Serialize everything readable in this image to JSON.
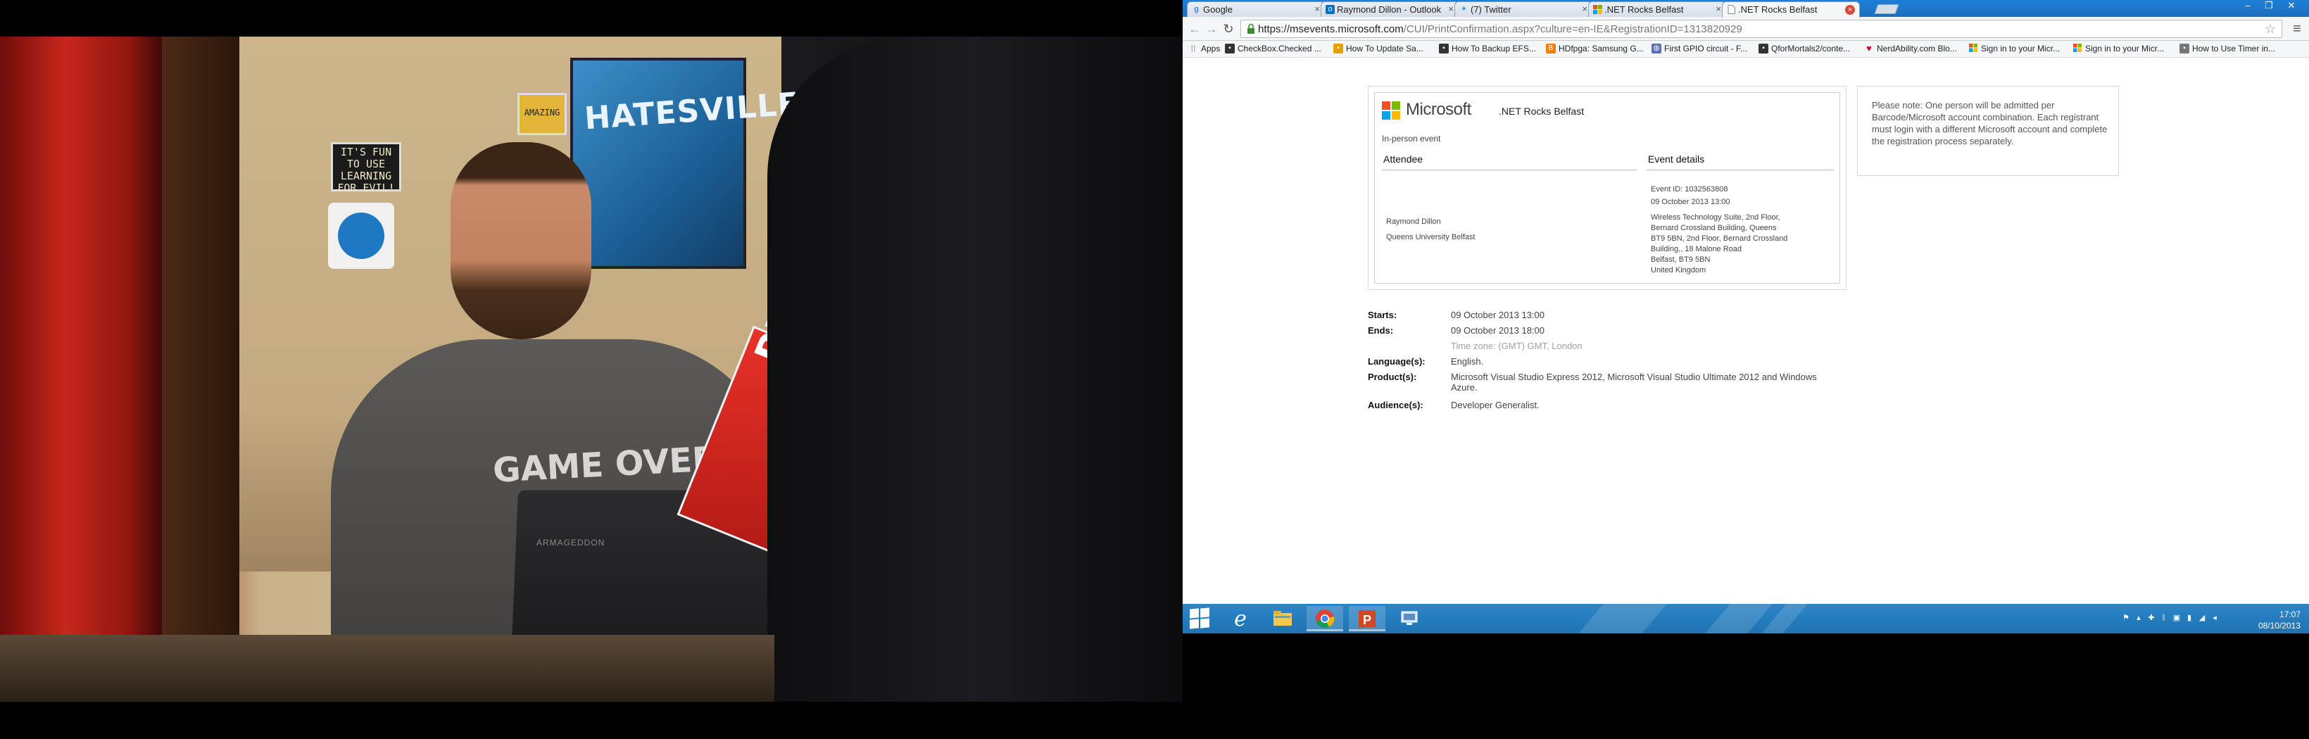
{
  "video": {
    "poster_text": "HATESVILLE!",
    "sticker_1": "IT'S FUN TO USE LEARNING FOR EVIL!",
    "sticker_2": "AMAZING",
    "shirt_text": "GAME OVER,",
    "laptop_label": "ARMAGEDDON",
    "book_text": "PUSSEY!"
  },
  "browser": {
    "tabs": [
      {
        "label": "Google",
        "icon": "google-icon",
        "color": "#4285f4"
      },
      {
        "label": "Raymond Dillon - Outlook",
        "icon": "outlook-icon",
        "color": "#0072c6"
      },
      {
        "label": "(7) Twitter",
        "icon": "twitter-icon",
        "color": "#1da1f2"
      },
      {
        "label": ".NET Rocks Belfast",
        "icon": "microsoft-icon",
        "color": "#f25022"
      },
      {
        "label": ".NET Rocks Belfast",
        "icon": "page-icon",
        "color": "#9aa0a6"
      }
    ],
    "url_host": "https://msevents.microsoft.com",
    "url_path": "/CUI/PrintConfirmation.aspx?culture=en-IE&RegistrationID=1313820929",
    "bookmarks": [
      {
        "label": "Apps",
        "icon": "apps-grid-icon",
        "color": "#5f6368"
      },
      {
        "label": "CheckBox.Checked ...",
        "icon": "bookmark-page-icon",
        "color": "#333333"
      },
      {
        "label": "How To Update Sa...",
        "icon": "bookmark-folder-icon",
        "color": "#e6a100"
      },
      {
        "label": "How To Backup EFS...",
        "icon": "bookmark-page-icon",
        "color": "#333333"
      },
      {
        "label": "HDfpga: Samsung G...",
        "icon": "blogger-icon",
        "color": "#f57d00"
      },
      {
        "label": "First GPIO circuit - F...",
        "icon": "globe-icon",
        "color": "#5b6fb5"
      },
      {
        "label": "QforMortals2/conte...",
        "icon": "bookmark-page-icon",
        "color": "#333333"
      },
      {
        "label": "NerdAbility.com Blo...",
        "icon": "heart-icon",
        "color": "#d0021b"
      },
      {
        "label": "Sign in to your Micr...",
        "icon": "microsoft-icon",
        "color": "#f25022"
      },
      {
        "label": "Sign in to your Micr...",
        "icon": "microsoft-icon",
        "color": "#f25022"
      },
      {
        "label": "How to Use Timer in...",
        "icon": "bookmark-page-icon",
        "color": "#777777"
      }
    ]
  },
  "page": {
    "brand": "Microsoft",
    "event_name": ".NET Rocks Belfast",
    "event_type": "In-person event",
    "attendee_heading": "Attendee",
    "details_heading": "Event details",
    "attendee_name": "Raymond Dillon",
    "attendee_org": "Queens University Belfast",
    "event_id": "Event ID: 1032563808",
    "event_datetime": "09 October 2013 13:00",
    "venue_lines": [
      "Wireless Technology Suite, 2nd Floor,",
      "Bernard Crossland Building, Queens",
      "BT9 5BN, 2nd Floor, Bernard Crossland",
      "Building,, 18 Malone Road",
      "Belfast, BT9 5BN",
      "United Kingdom"
    ],
    "notice": "Please note: One person will be admitted per Barcode/Microsoft account combination. Each registrant must login with a different Microsoft account and complete the registration process separately.",
    "details": {
      "starts_label": "Starts:",
      "starts_value": "09 October 2013 13:00",
      "ends_label": "Ends:",
      "ends_value": "09 October 2013 18:00",
      "timezone": "Time zone: (GMT) GMT, London",
      "languages_label": "Language(s):",
      "languages_value": "English.",
      "products_label": "Product(s):",
      "products_value": "Microsoft Visual Studio Express 2012, Microsoft Visual Studio Ultimate 2012 and Windows Azure.",
      "audiences_label": "Audience(s):",
      "audiences_value": "Developer Generalist."
    }
  },
  "taskbar": {
    "apps": [
      "internet-explorer-icon",
      "file-explorer-icon",
      "chrome-icon",
      "powerpoint-icon",
      "remote-desktop-icon"
    ],
    "time": "17:07",
    "date": "08/10/2013"
  }
}
